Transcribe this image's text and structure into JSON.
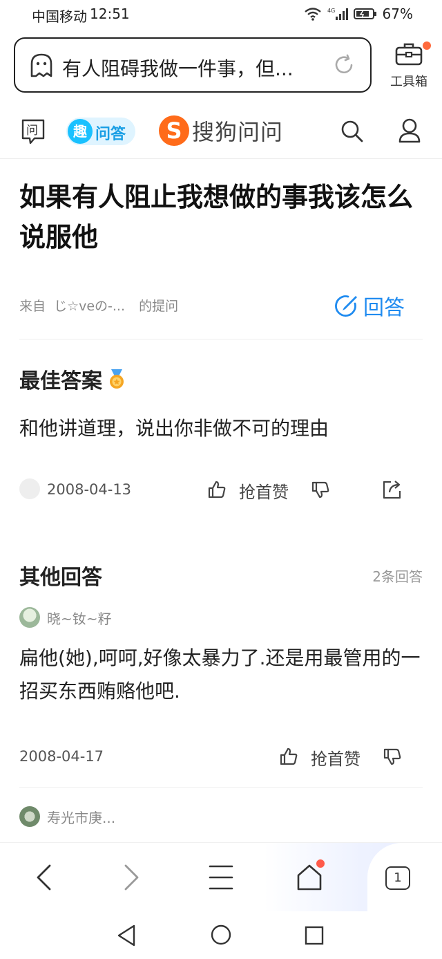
{
  "status_bar": {
    "carrier": "中国移动",
    "time": "12:51",
    "battery": "67%",
    "icons": [
      "wifi-icon",
      "signal-4g-icon",
      "battery-icon"
    ]
  },
  "browser": {
    "search_query": "有人阻碍我做一件事，但...",
    "toolbox_label": "工具箱"
  },
  "site_header": {
    "qu_tag": "问答",
    "qu_badge": "趣",
    "brand_name": "搜狗问问",
    "brand_logo_letter": "S"
  },
  "question": {
    "title": "如果有人阻止我想做的事我该怎么说服他",
    "from_prefix": "来自",
    "asker": "じ☆veの-...",
    "from_suffix": "的提问",
    "answer_button": "回答"
  },
  "best_answer": {
    "heading": "最佳答案",
    "body": "和他讲道理，说出你非做不可的理由",
    "date": "2008-04-13",
    "like_label": "抢首赞"
  },
  "other_answers": {
    "heading": "其他回答",
    "count": "2条回答",
    "items": [
      {
        "user": "晓~钕~籽",
        "body": "扁他(她),呵呵,好像太暴力了.还是用最管用的一招买东西贿赂他吧.",
        "date": "2008-04-17",
        "like_label": "抢首赞"
      },
      {
        "user": "寿光市庚..."
      }
    ]
  },
  "bottom_nav": {
    "tab_count": "1"
  },
  "colors": {
    "accent_blue": "#1f8bf0",
    "brand_orange": "#ff6b1a",
    "badge_red": "#ff5a4a"
  }
}
